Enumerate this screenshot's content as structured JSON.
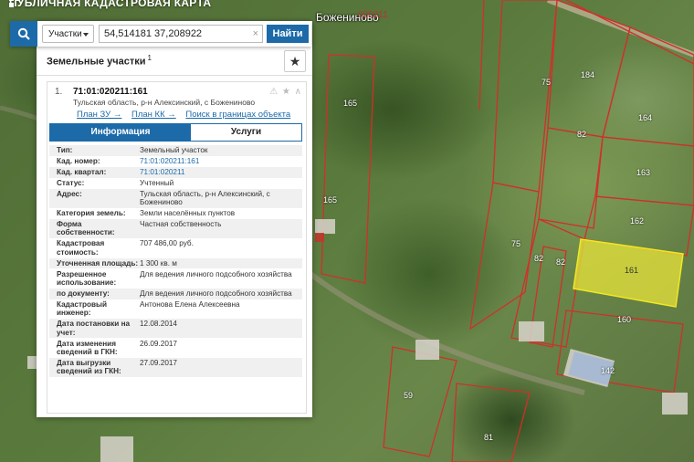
{
  "app": {
    "title": "ПУБЛИЧНАЯ КАДАСТРОВАЯ КАРТА"
  },
  "map": {
    "village_name": "Божениново",
    "village_code": "020211",
    "parcel_labels": [
      "165",
      "75",
      "184",
      "164",
      "82",
      "163",
      "165",
      "162",
      "75",
      "82",
      "82",
      "161",
      "160",
      "59",
      "142",
      "81"
    ],
    "selected_parcel": "161",
    "selected_color": "#e8e43a"
  },
  "search": {
    "category": "Участки",
    "query": "54,514181 37,208922",
    "button": "Найти",
    "clear": "×"
  },
  "panel": {
    "title": "Земельные участки",
    "count": "1",
    "star": "★"
  },
  "card": {
    "index": "1.",
    "cad_number": "71:01:020211:161",
    "address": "Тульская область, р-н Алексинский, с Божениново",
    "icons": "⚠ ★ ∧",
    "links": [
      "План ЗУ →",
      "План КК →",
      "Поиск в границах объекта →"
    ],
    "tabs": {
      "info": "Информация",
      "services": "Услуги"
    }
  },
  "info": [
    {
      "k": "Тип:",
      "v": "Земельный участок",
      "link": false
    },
    {
      "k": "Кад. номер:",
      "v": "71:01:020211:161",
      "link": true
    },
    {
      "k": "Кад. квартал:",
      "v": "71:01:020211",
      "link": true
    },
    {
      "k": "Статус:",
      "v": "Учтенный",
      "link": false
    },
    {
      "k": "Адрес:",
      "v": "Тульская область, р-н Алексинский, с Божениново",
      "link": false
    },
    {
      "k": "Категория земель:",
      "v": "Земли населённых пунктов",
      "link": false
    },
    {
      "k": "Форма собственности:",
      "v": "Частная собственность",
      "link": false
    },
    {
      "k": "Кадастровая стоимость:",
      "v": "707 486,00 руб.",
      "link": false
    },
    {
      "k": "Уточненная площадь:",
      "v": "1 300 кв. м",
      "link": false
    },
    {
      "k": "Разрешенное использование:",
      "v": "Для ведения личного подсобного хозяйства",
      "link": false
    },
    {
      "k": "по документу:",
      "v": "Для ведения личного подсобного хозяйства",
      "link": false
    },
    {
      "k": "Кадастровый инженер:",
      "v": "Антонова Елена Алексеевна",
      "link": false
    },
    {
      "k": "Дата постановки на учет:",
      "v": "12.08.2014",
      "link": false
    },
    {
      "k": "Дата изменения сведений в ГКН:",
      "v": "26.09.2017",
      "link": false
    },
    {
      "k": "Дата выгрузки сведений из ГКН:",
      "v": "27.09.2017",
      "link": false
    }
  ]
}
